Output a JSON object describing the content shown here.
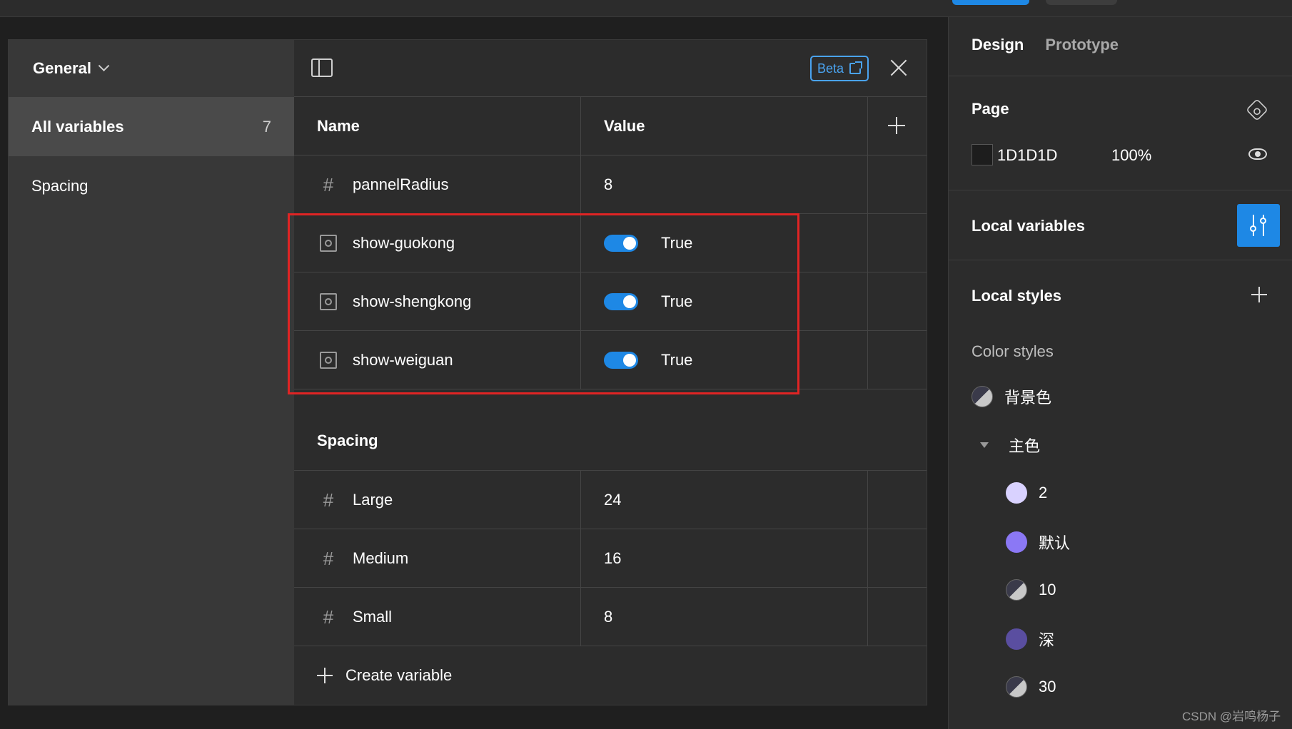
{
  "modal": {
    "collection_name": "General",
    "sidebar": [
      {
        "label": "All variables",
        "count": "7"
      },
      {
        "label": "Spacing"
      }
    ],
    "beta_label": "Beta",
    "columns": {
      "name": "Name",
      "value": "Value"
    },
    "rows": [
      {
        "type": "number",
        "name": "pannelRadius",
        "value": "8"
      },
      {
        "type": "boolean",
        "name": "show-guokong",
        "value": "True"
      },
      {
        "type": "boolean",
        "name": "show-shengkong",
        "value": "True"
      },
      {
        "type": "boolean",
        "name": "show-weiguan",
        "value": "True"
      }
    ],
    "group": {
      "title": "Spacing",
      "rows": [
        {
          "type": "number",
          "name": "Large",
          "value": "24"
        },
        {
          "type": "number",
          "name": "Medium",
          "value": "16"
        },
        {
          "type": "number",
          "name": "Small",
          "value": "8"
        }
      ]
    },
    "create_label": "Create variable"
  },
  "right_panel": {
    "tabs": [
      "Design",
      "Prototype"
    ],
    "page": {
      "title": "Page",
      "color_hex": "1D1D1D",
      "opacity": "100%"
    },
    "local_variables": "Local variables",
    "local_styles": "Local styles",
    "color_styles_title": "Color styles",
    "styles": [
      {
        "label": "背景色",
        "swatch": "mixed"
      },
      {
        "label": "主色",
        "group": true
      },
      {
        "label": "2",
        "swatch": "#d9d2ff"
      },
      {
        "label": "默认",
        "swatch": "#8b78f5"
      },
      {
        "label": "10",
        "swatch": "mixed"
      },
      {
        "label": "深",
        "swatch": "#5a4ea0"
      },
      {
        "label": "30",
        "swatch": "mixed"
      }
    ]
  },
  "watermark": "CSDN @岩鸣杨子",
  "colors": {
    "accent": "#1e88e5",
    "highlight": "#e02424",
    "background": "#2c2c2c"
  }
}
